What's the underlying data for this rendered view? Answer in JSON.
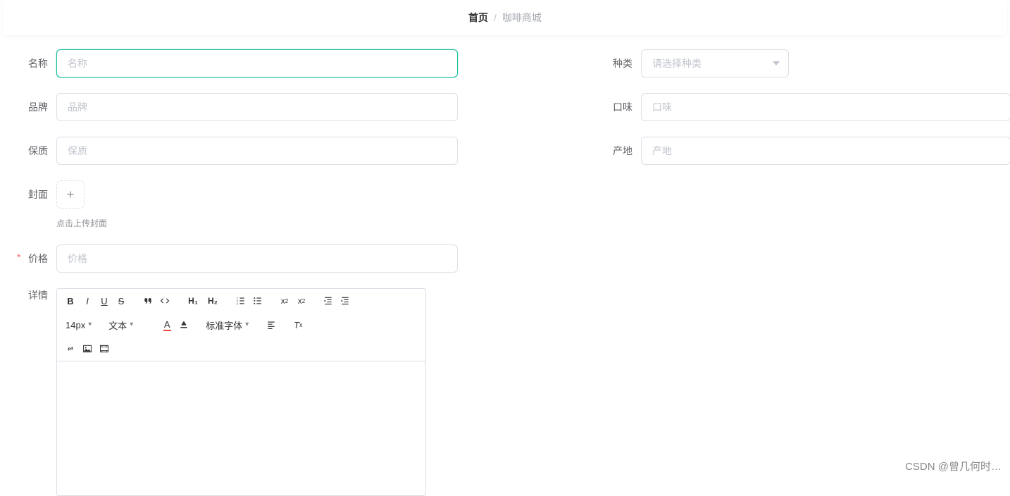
{
  "breadcrumb": {
    "home": "首页",
    "current": "咖啡商城",
    "sep": "/"
  },
  "form": {
    "name": {
      "label": "名称",
      "placeholder": "名称",
      "value": ""
    },
    "type": {
      "label": "种类",
      "placeholder": "请选择种类"
    },
    "brand": {
      "label": "品牌",
      "placeholder": "品牌",
      "value": ""
    },
    "taste": {
      "label": "口味",
      "placeholder": "口味",
      "value": ""
    },
    "shelf": {
      "label": "保质",
      "placeholder": "保质",
      "value": ""
    },
    "origin": {
      "label": "产地",
      "placeholder": "产地",
      "value": ""
    },
    "cover": {
      "label": "封面",
      "hint": "点击上传封面"
    },
    "price": {
      "label": "价格",
      "placeholder": "价格",
      "value": ""
    },
    "detail": {
      "label": "详情"
    }
  },
  "editor": {
    "fontSize": "14px",
    "blockType": "文本",
    "fontFamily": "标准字体"
  },
  "watermark": "CSDN @曾几何时…"
}
